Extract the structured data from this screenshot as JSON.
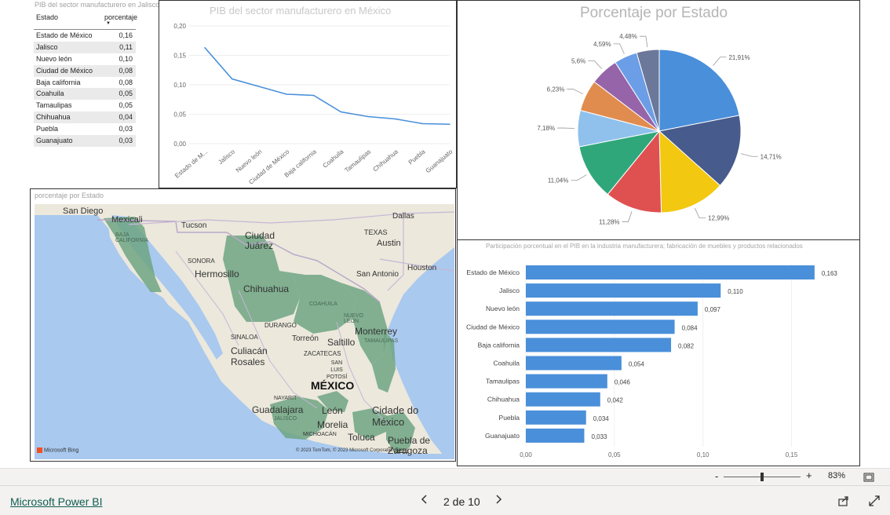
{
  "table": {
    "title": "PIB del sector manufacturero en Jalisco",
    "col_estado": "Estado",
    "col_porcentaje": "porcentaje",
    "sort_icon": "caret-down-icon",
    "rows": [
      {
        "estado": "Estado de México",
        "pct": "0,16"
      },
      {
        "estado": "Jalisco",
        "pct": "0,11"
      },
      {
        "estado": "Nuevo león",
        "pct": "0,10"
      },
      {
        "estado": "Ciudad de México",
        "pct": "0,08"
      },
      {
        "estado": "Baja california",
        "pct": "0,08"
      },
      {
        "estado": "Coahuila",
        "pct": "0,05"
      },
      {
        "estado": "Tamaulipas",
        "pct": "0,05"
      },
      {
        "estado": "Chihuahua",
        "pct": "0,04"
      },
      {
        "estado": "Puebla",
        "pct": "0,03"
      },
      {
        "estado": "Guanajuato",
        "pct": "0,03"
      }
    ]
  },
  "line_chart": {
    "title": "PIB del sector manufacturero en México",
    "color": "#4a8fd9",
    "chart_data": {
      "type": "line",
      "categories": [
        "Estado de M...",
        "Jalisco",
        "Nuevo león",
        "Ciudad de México",
        "Baja california",
        "Coahuila",
        "Tamaulipas",
        "Chihuahua",
        "Puebla",
        "Guanajuato"
      ],
      "values": [
        0.163,
        0.11,
        0.097,
        0.084,
        0.082,
        0.054,
        0.046,
        0.042,
        0.034,
        0.033
      ],
      "yticks": [
        "0,00",
        "0,05",
        "0,10",
        "0,15",
        "0,20"
      ],
      "ylim": [
        0,
        0.2
      ],
      "grid": true
    }
  },
  "pie_chart": {
    "title": "Porcentaje por Estado",
    "chart_data": {
      "type": "pie",
      "labels": [
        "21,91%",
        "14,71%",
        "12,99%",
        "11,28%",
        "11,04%",
        "7,18%",
        "6,23%",
        "5,6%",
        "4,59%",
        "4,48%"
      ],
      "values": [
        21.91,
        14.71,
        12.99,
        11.28,
        11.04,
        7.18,
        6.23,
        5.6,
        4.59,
        4.48
      ],
      "colors": [
        "#4a8fd9",
        "#475b8c",
        "#f2c811",
        "#df5150",
        "#30a77a",
        "#8fc1ec",
        "#e08c4f",
        "#9664a8",
        "#6b9ee6",
        "#6c789a"
      ]
    }
  },
  "map": {
    "title": "porcentaje por Estado",
    "bing_label": "Microsoft Bing",
    "copyright": "© 2023 TomTom, © 2023 Microsoft Corporation",
    "terms": "Terms",
    "labels": {
      "san_diego": "San Diego",
      "mexicali": "Mexicali",
      "baja_california": "BAJA CALIFORNIA",
      "tucson": "Tucson",
      "dallas": "Dallas",
      "texas": "TEXAS",
      "austin": "Austin",
      "ciudad_juarez": "Ciudad Juárez",
      "sonora": "SONORA",
      "hermosillo": "Hermosillo",
      "chihuahua": "Chihuahua",
      "san_antonio": "San Antonio",
      "houston": "Houston",
      "coahuila": "COAHUILA",
      "nuevo_leon": "NUEVO LEÓN",
      "monterrey": "Monterrey",
      "tamaulipas": "TAMAULIPAS",
      "durango": "DURANGO",
      "sinaloa": "SINALOA",
      "torreon": "Torreón",
      "saltillo": "Saltillo",
      "culiacan": "Culiacán Rosales",
      "zacatecas": "ZACATECAS",
      "san_luis": "SAN LUIS POTOSÍ",
      "mexico": "MÉXICO",
      "nayarit": "NAYARIT",
      "guadalajara": "Guadalajara",
      "jalisco": "JALISCO",
      "leon": "León",
      "morelia": "Morelia",
      "michoacan": "MICHOACÁN",
      "toluca": "Toluca",
      "cdmx": "Cidade do México",
      "puebla": "Puebla de Zaragoza"
    }
  },
  "bar_chart": {
    "title": "Participación porcentual en el PIB en la industria manufacturera; fabricación de muebles y productos relacionados",
    "color": "#4a8fd9",
    "chart_data": {
      "type": "bar",
      "categories": [
        "Estado de México",
        "Jalisco",
        "Nuevo león",
        "Ciudad de México",
        "Baja california",
        "Coahuila",
        "Tamaulipas",
        "Chihuahua",
        "Puebla",
        "Guanajuato"
      ],
      "values": [
        0.163,
        0.11,
        0.097,
        0.084,
        0.082,
        0.054,
        0.046,
        0.042,
        0.034,
        0.033
      ],
      "value_labels": [
        "0,163",
        "0,110",
        "0,097",
        "0,084",
        "0,082",
        "0,054",
        "0,046",
        "0,042",
        "0,034",
        "0,033"
      ],
      "xticks": [
        "0,00",
        "0,05",
        "0,10",
        "0,15"
      ],
      "xlim": [
        0,
        0.183
      ]
    }
  },
  "zoom": {
    "minus": "-",
    "plus": "+",
    "value": "83%",
    "level": 0.5,
    "fit_icon": "fit-to-page-icon"
  },
  "footer": {
    "brand": "Microsoft Power BI",
    "prev_icon": "chevron-left-icon",
    "page": "2 de 10",
    "next_icon": "chevron-right-icon",
    "share_icon": "share-icon",
    "fullscreen_icon": "fullscreen-icon"
  }
}
